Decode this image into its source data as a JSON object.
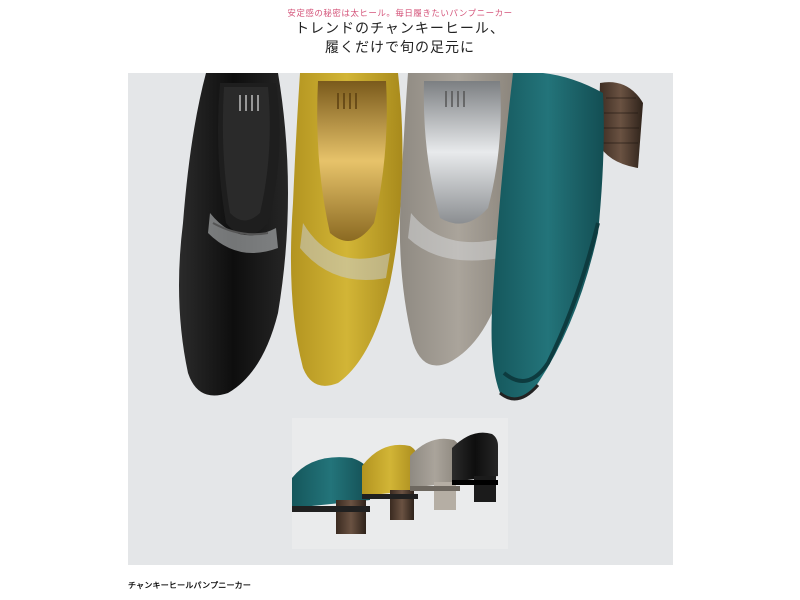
{
  "header": {
    "tagline": "安定感の秘密は太ヒール。毎日履きたいパンプニーカー",
    "headline_line1": "トレンドのチャンキーヒール、",
    "headline_line2": "履くだけで旬の足元に"
  },
  "caption": "チャンキーヒールパンプニーカー",
  "colors": {
    "tagline": "#d4547a",
    "background_panel": "#e4e6e8",
    "shoe_black": "#141414",
    "shoe_mustard": "#c4a728",
    "shoe_taupe": "#9c968d",
    "shoe_teal": "#1d6a70"
  }
}
